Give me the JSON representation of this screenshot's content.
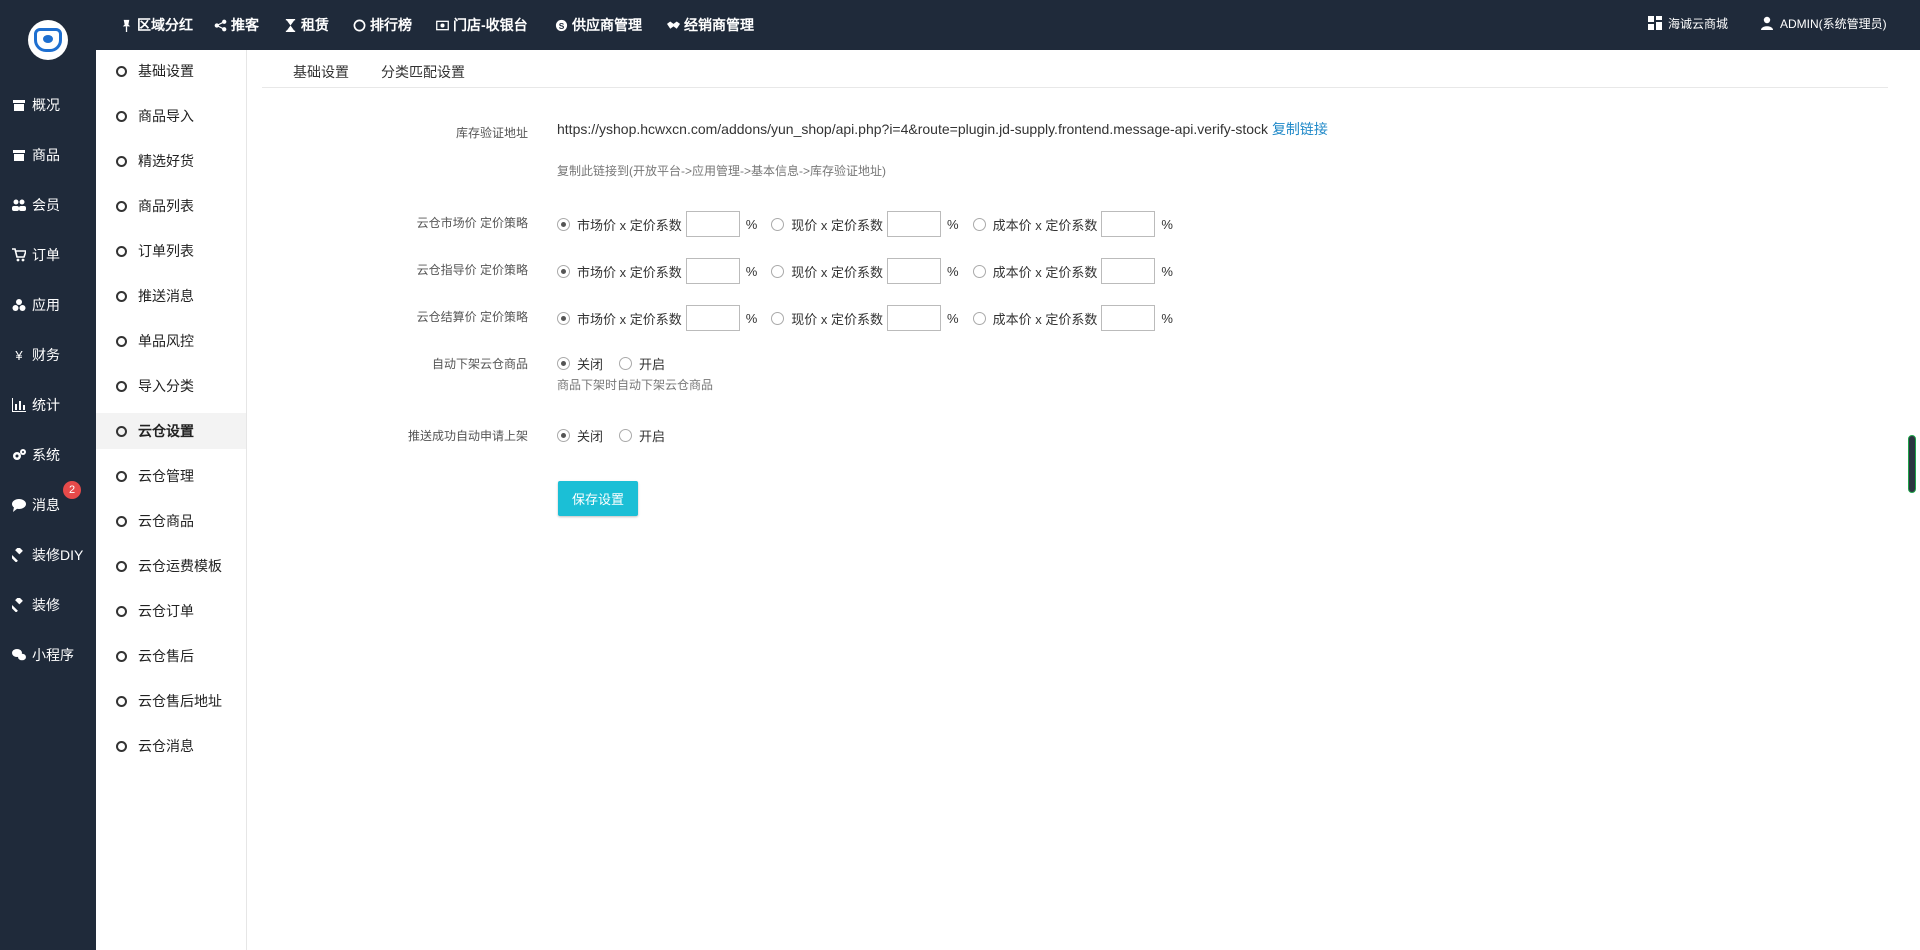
{
  "leftnav": {
    "items": [
      {
        "label": "概况",
        "icon": "box-icon"
      },
      {
        "label": "商品",
        "icon": "box-icon"
      },
      {
        "label": "会员",
        "icon": "users-icon"
      },
      {
        "label": "订单",
        "icon": "cart-icon"
      },
      {
        "label": "应用",
        "icon": "cubes-icon"
      },
      {
        "label": "财务",
        "icon": "yen-icon"
      },
      {
        "label": "统计",
        "icon": "bar-chart-icon"
      },
      {
        "label": "系统",
        "icon": "gears-icon"
      },
      {
        "label": "消息",
        "icon": "comment-icon"
      },
      {
        "label": "装修DIY",
        "icon": "gavel-icon"
      },
      {
        "label": "装修",
        "icon": "gavel-icon"
      },
      {
        "label": "小程序",
        "icon": "wechat-icon"
      }
    ],
    "message_badge": "2"
  },
  "topbar": {
    "links": [
      {
        "label": "区域分红",
        "icon": "pin-icon"
      },
      {
        "label": "推客",
        "icon": "share-icon"
      },
      {
        "label": "租赁",
        "icon": "hourglass-icon"
      },
      {
        "label": "排行榜",
        "icon": "circle-icon"
      },
      {
        "label": "门店-收银台",
        "icon": "cash-icon"
      },
      {
        "label": "供应商管理",
        "icon": "skype-icon"
      },
      {
        "label": "经销商管理",
        "icon": "handshake-icon"
      }
    ],
    "shop_name": "海诚云商城",
    "user_name": "ADMIN(系统管理员)"
  },
  "subnav": {
    "items": [
      {
        "label": "基础设置"
      },
      {
        "label": "商品导入"
      },
      {
        "label": "精选好货"
      },
      {
        "label": "商品列表"
      },
      {
        "label": "订单列表"
      },
      {
        "label": "推送消息"
      },
      {
        "label": "单品风控"
      },
      {
        "label": "导入分类"
      },
      {
        "label": "云仓设置"
      },
      {
        "label": "云仓管理"
      },
      {
        "label": "云仓商品"
      },
      {
        "label": "云仓运费模板"
      },
      {
        "label": "云仓订单"
      },
      {
        "label": "云仓售后"
      },
      {
        "label": "云仓售后地址"
      },
      {
        "label": "云仓消息"
      }
    ],
    "active_index": 8
  },
  "tabs": [
    "基础设置",
    "分类匹配设置"
  ],
  "form": {
    "stock_url_label": "库存验证地址",
    "stock_url": "https://yshop.hcwxcn.com/addons/yun_shop/api.php?i=4&route=plugin.jd-supply.frontend.message-api.verify-stock",
    "copy_link": "复制链接",
    "stock_url_help": "复制此链接到(开放平台->应用管理->基本信息->库存验证地址)",
    "pricing_rows": [
      {
        "label": "云仓市场价 定价策略",
        "selected": 0,
        "options": [
          "市场价 x 定价系数",
          "现价 x 定价系数",
          "成本价 x 定价系数"
        ],
        "values": [
          "",
          "",
          ""
        ]
      },
      {
        "label": "云仓指导价 定价策略",
        "selected": 0,
        "options": [
          "市场价 x 定价系数",
          "现价 x 定价系数",
          "成本价 x 定价系数"
        ],
        "values": [
          "",
          "",
          ""
        ]
      },
      {
        "label": "云仓结算价 定价策略",
        "selected": 0,
        "options": [
          "市场价 x 定价系数",
          "现价 x 定价系数",
          "成本价 x 定价系数"
        ],
        "values": [
          "",
          "",
          ""
        ]
      }
    ],
    "percent": "%",
    "auto_offshelf_label": "自动下架云仓商品",
    "auto_offshelf_options": [
      "关闭",
      "开启"
    ],
    "auto_offshelf_help": "商品下架时自动下架云仓商品",
    "auto_apply_label": "推送成功自动申请上架",
    "auto_apply_options": [
      "关闭",
      "开启"
    ],
    "save_label": "保存设置"
  }
}
